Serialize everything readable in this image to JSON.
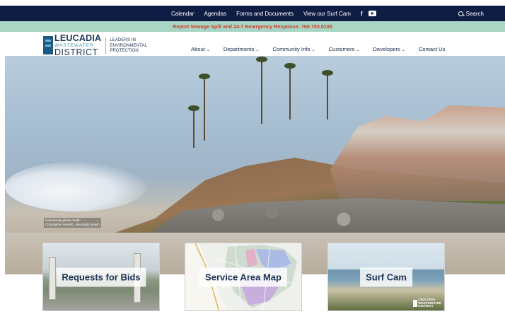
{
  "topbar": {
    "links": [
      "Calendar",
      "Agendas",
      "Forms and Documents",
      "View our Surf Cam"
    ],
    "facebook_label": "f",
    "search_label": "Search"
  },
  "alert": {
    "text": "Report Sewage Spill and 24-7 Emergency Response: 760.753.0155",
    "color": "#cf3a2b"
  },
  "logo": {
    "line1": "LEUCADIA",
    "line2": "WASTEWATER",
    "line3": "DISTRICT",
    "tagline1": "LEADERS IN",
    "tagline2": "ENVIRONMENTAL",
    "tagline3": "PROTECTION"
  },
  "nav": {
    "items": [
      {
        "label": "About",
        "dropdown": true
      },
      {
        "label": "Departments",
        "dropdown": true
      },
      {
        "label": "Community Info",
        "dropdown": true
      },
      {
        "label": "Customers",
        "dropdown": true
      },
      {
        "label": "Developers",
        "dropdown": true
      },
      {
        "label": "Contact Us",
        "dropdown": false
      }
    ]
  },
  "hero": {
    "credit_line1": "Community photo credit:",
    "credit_line2": "Christopher Morello, Moonlight Beach"
  },
  "cards": [
    {
      "label": "Requests for Bids"
    },
    {
      "label": "Service Area Map"
    },
    {
      "label": "Surf Cam"
    }
  ],
  "colors": {
    "topbar_bg": "#0f1d45",
    "alert_bg": "#a9d6c4",
    "brand_navy": "#1d3555"
  }
}
